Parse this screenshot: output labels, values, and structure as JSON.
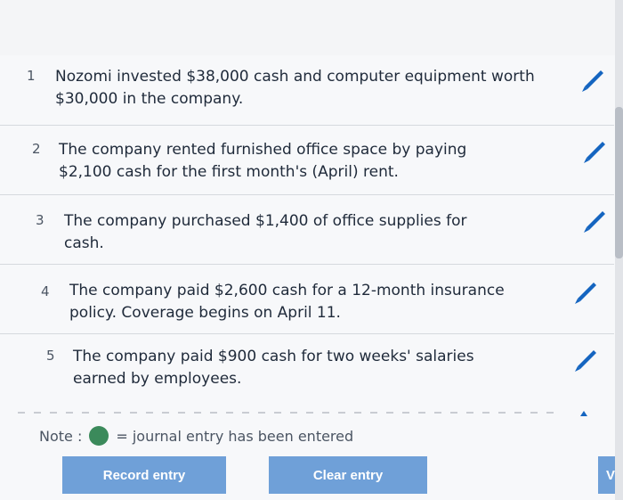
{
  "entries": [
    {
      "num": "1",
      "text": "Nozomi invested $38,000 cash and computer equipment worth $30,000 in the company."
    },
    {
      "num": "2",
      "text": "The company rented furnished office space by paying $2,100 cash for the first month's (April) rent."
    },
    {
      "num": "3",
      "text": "The company purchased $1,400 of office supplies for cash."
    },
    {
      "num": "4",
      "text": "The company paid $2,600 cash for a 12-month insurance policy. Coverage begins on April 11."
    },
    {
      "num": "5",
      "text": "The company paid $900 cash for two weeks' salaries earned by employees."
    }
  ],
  "note": {
    "label": "Note :",
    "text": "= journal entry has been entered",
    "dot_color": "#3b8a5b"
  },
  "buttons": {
    "record": "Record entry",
    "clear": "Clear entry",
    "side": "V"
  },
  "colors": {
    "accent": "#1565c0",
    "button": "#6fa0d8"
  },
  "icons": {
    "edit": "pencil-icon"
  }
}
